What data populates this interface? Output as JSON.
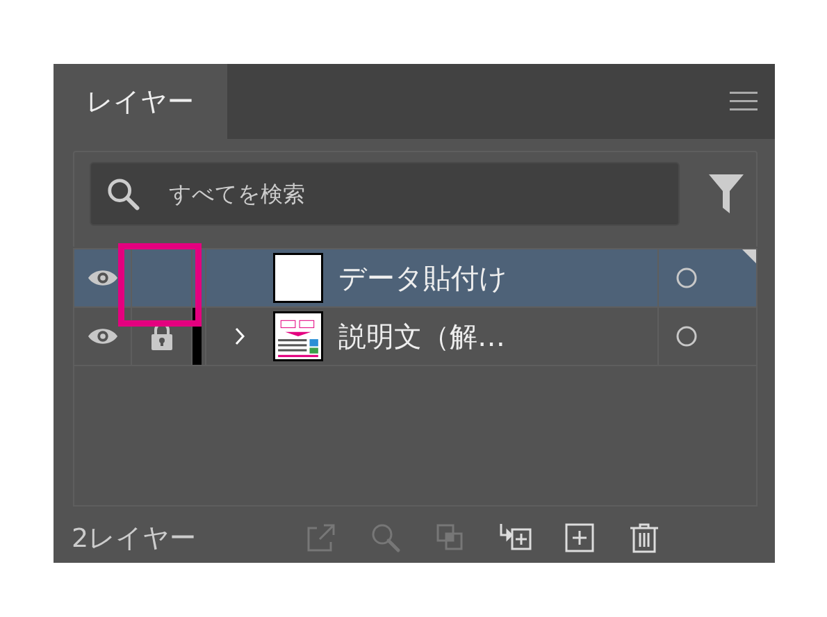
{
  "panel": {
    "tab": {
      "label": "レイヤー",
      "selected": true
    },
    "search": {
      "placeholder": "すべてを検索"
    },
    "layers": [
      {
        "name": "データ貼付け",
        "visible": true,
        "locked": false,
        "expandable": false,
        "selected": true,
        "kind": "blank",
        "targeted": true
      },
      {
        "name": "説明文（解…",
        "visible": true,
        "locked": true,
        "expandable": true,
        "selected": false,
        "color": "#000000",
        "kind": "document",
        "targeted": false
      }
    ],
    "footer": {
      "count": "2レイヤー",
      "tools": [
        {
          "kind": "export",
          "disabled": true
        },
        {
          "kind": "search",
          "disabled": true
        },
        {
          "kind": "mask",
          "disabled": true
        },
        {
          "kind": "sublayer",
          "disabled": false
        },
        {
          "kind": "new",
          "disabled": false
        },
        {
          "kind": "trash",
          "disabled": false
        }
      ]
    }
  },
  "annotation": {
    "color": "#e4007f"
  }
}
